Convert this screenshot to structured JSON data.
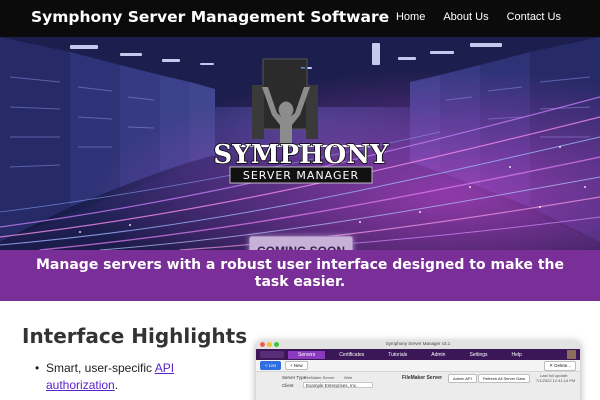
{
  "header": {
    "brand": "Symphony Server Management Software",
    "nav": [
      {
        "label": "Home"
      },
      {
        "label": "About Us"
      },
      {
        "label": "Contact Us"
      }
    ]
  },
  "hero": {
    "logo_text": "SYMPHONY",
    "logo_subtext": "SERVER MANAGER",
    "cta_label": "COMING SOON"
  },
  "banner": {
    "text": "Manage servers with a robust user interface designed to make the task easier."
  },
  "highlights": {
    "title": "Interface Highlights",
    "items": [
      {
        "prefix": "Smart, user-specific ",
        "link": "API authorization",
        "suffix": "."
      }
    ]
  },
  "app_preview": {
    "window_title": "Symphony Server Manager v3.1",
    "menu": [
      "Servers",
      "Certificates",
      "Tutorials",
      "Admin",
      "Settings",
      "Help"
    ],
    "active_menu": "Servers",
    "toolbar": {
      "list": "< List",
      "new": "+ New",
      "delete": "✕ Delete..."
    },
    "fields": {
      "server_type_label": "Server Type",
      "server_type_value": "FileMaker Server",
      "server_type_alt": "Web",
      "client_label": "Client",
      "client_value": "Example Enterprises, Inc."
    },
    "server_panel": {
      "title": "FileMaker Server",
      "admin_api": "Admin API",
      "refresh": "Refresh All Server Data",
      "last_update_label": "Last full update:",
      "last_update_value": "7/1/2022 12:41:14 PM"
    }
  },
  "colors": {
    "topbar": "#0b0b0b",
    "banner": "#7a2e97",
    "cta_bg": "#c7b1d7",
    "link": "#5a22c9"
  }
}
